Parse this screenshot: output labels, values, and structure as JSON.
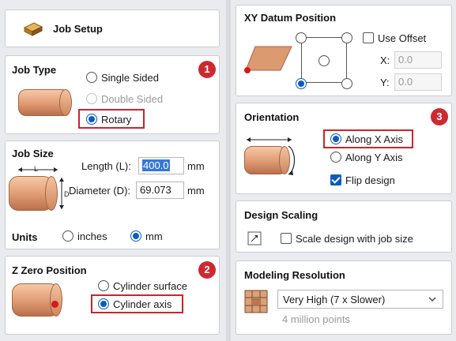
{
  "job_setup": {
    "title": "Job Setup"
  },
  "job_type": {
    "title": "Job Type",
    "options": [
      "Single Sided",
      "Double Sided",
      "Rotary"
    ],
    "selected": "Rotary",
    "badge": "1"
  },
  "job_size": {
    "title": "Job Size",
    "length_label": "Length (L):",
    "length_value": "400.0",
    "length_unit": "mm",
    "diameter_label": "Diameter (D):",
    "diameter_value": "69.073",
    "diameter_unit": "mm",
    "diagram_l": "L",
    "diagram_d": "D",
    "units_label": "Units",
    "units_options": [
      "inches",
      "mm"
    ],
    "units_selected": "mm"
  },
  "z_zero": {
    "title": "Z Zero Position",
    "options": [
      "Cylinder surface",
      "Cylinder axis"
    ],
    "selected": "Cylinder axis",
    "badge": "2"
  },
  "xy_datum": {
    "title": "XY Datum Position",
    "use_offset_label": "Use Offset",
    "use_offset_checked": false,
    "x_label": "X:",
    "x_value": "0.0",
    "y_label": "Y:",
    "y_value": "0.0"
  },
  "orientation": {
    "title": "Orientation",
    "options": [
      "Along X Axis",
      "Along Y Axis"
    ],
    "selected": "Along X Axis",
    "flip_label": "Flip design",
    "flip_checked": true,
    "badge": "3"
  },
  "design_scaling": {
    "title": "Design Scaling",
    "scale_label": "Scale design with job size",
    "scale_checked": false
  },
  "modeling_resolution": {
    "title": "Modeling Resolution",
    "selected": "Very High (7 x Slower)",
    "hint": "4 million points"
  },
  "colors": {
    "accent": "#0a5bc4",
    "highlight": "#c9252b",
    "badge": "#cc2a31",
    "wood": "#df9a72"
  }
}
